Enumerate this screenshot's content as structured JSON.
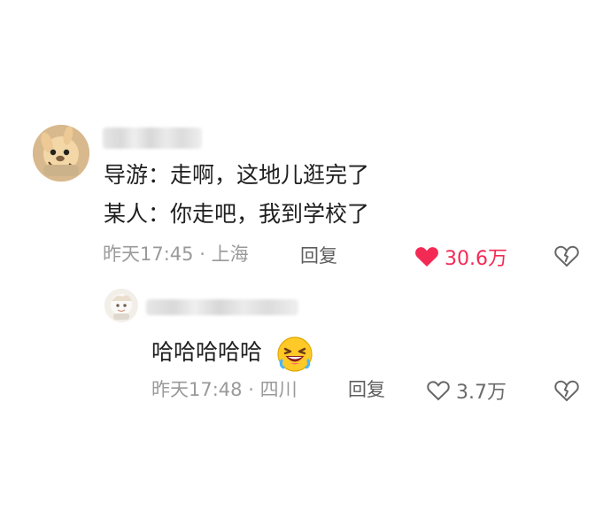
{
  "comment": {
    "lines": [
      "导游：走啊，这地儿逛完了",
      "某人：你走吧，我到学校了"
    ],
    "meta": {
      "time": "昨天17:45",
      "separator": "·",
      "location": "上海"
    },
    "actions": {
      "reply_label": "回复",
      "likes": "30.6万",
      "liked": true
    }
  },
  "reply": {
    "text": "哈哈哈哈哈",
    "meta": {
      "time": "昨天17:48",
      "separator": "·",
      "location": "四川"
    },
    "actions": {
      "reply_label": "回复",
      "likes": "3.7万",
      "liked": false
    }
  },
  "icons": {
    "heart_filled": "heart-icon",
    "heart_outline": "heart-outline-icon",
    "broken_heart": "broken-heart-icon",
    "laughing_emoji": "laughing-face-icon"
  },
  "colors": {
    "liked": "#f32b54",
    "meta_text": "#9a9a9a",
    "action_text": "#5e5e5e"
  }
}
